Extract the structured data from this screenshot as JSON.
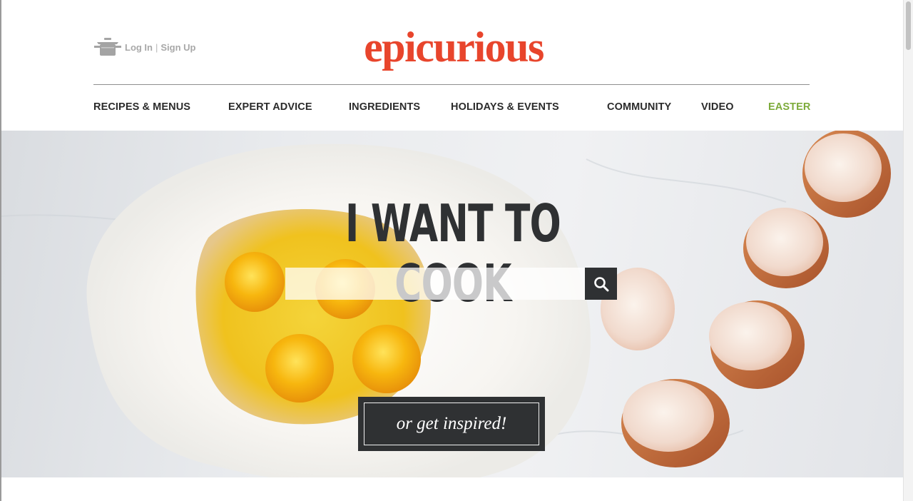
{
  "header": {
    "auth": {
      "login_label": "Log In",
      "separator": "|",
      "signup_label": "Sign Up",
      "icon": "pot-icon"
    },
    "logo_text": "epicurious"
  },
  "nav": {
    "items": [
      {
        "label": "RECIPES & MENUS"
      },
      {
        "label": "EXPERT ADVICE"
      },
      {
        "label": "INGREDIENTS"
      },
      {
        "label": "HOLIDAYS & EVENTS"
      },
      {
        "label": "COMMUNITY"
      },
      {
        "label": "VIDEO"
      },
      {
        "label": "EASTER"
      }
    ],
    "highlight_color": "#7dab3b"
  },
  "hero": {
    "title": "I WANT TO COOK",
    "search": {
      "value": "",
      "placeholder": "",
      "button_icon": "search-icon"
    },
    "inspire_label": "or get inspired!"
  },
  "colors": {
    "brand": "#e8452c",
    "nav_text": "#2b2b2b",
    "dark_ui": "#2f3133"
  }
}
